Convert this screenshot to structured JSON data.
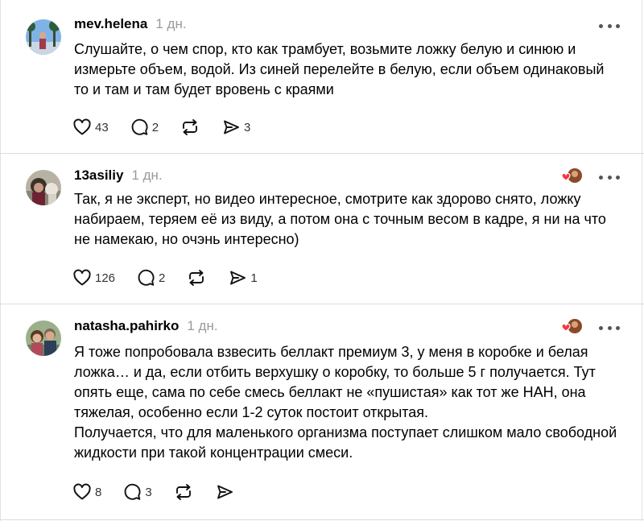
{
  "posts": [
    {
      "username": "mev.helena",
      "time": "1 дн.",
      "text": "Слушайте, о чем спор, кто как трамбует, возьмите ложку белую и синюю и измерьте объем, водой. Из синей перелейте в белую, если объем одинаковый то и там и там будет вровень с краями",
      "likes": "43",
      "replies": "2",
      "reposts": "",
      "shares": "3",
      "author_liked": false
    },
    {
      "username": "13asiliy",
      "time": "1 дн.",
      "text": "Так, я не эксперт, но видео интересное, смотрите как здорово снято, ложку набираем, теряем её из виду, а потом она с точным весом в кадре, я ни на что не намекаю, но очэнь интересно)",
      "likes": "126",
      "replies": "2",
      "reposts": "",
      "shares": "1",
      "author_liked": true
    },
    {
      "username": "natasha.pahirko",
      "time": "1 дн.",
      "text": "Я тоже попробовала взвесить беллакт премиум 3, у меня в коробке и белая ложка… и да, если отбить верхушку о коробку, то больше 5 г получается. Тут опять еще, сама по себе смесь беллакт не «пушистая» как тот же НАН, она тяжелая, особенно если 1-2 суток постоит открытая.\nПолучается, что для маленького организма поступает слишком мало свободной жидкости при такой концентрации смеси.",
      "likes": "8",
      "replies": "3",
      "reposts": "",
      "shares": "",
      "author_liked": true
    }
  ],
  "icons": {
    "like": "heart-icon",
    "reply": "comment-icon",
    "repost": "repost-icon",
    "share": "send-icon",
    "more": "more-icon"
  },
  "colors": {
    "text": "#000000",
    "muted": "#9a9a9a",
    "divider": "#dcdcdc",
    "like_red": "#ff3040"
  }
}
